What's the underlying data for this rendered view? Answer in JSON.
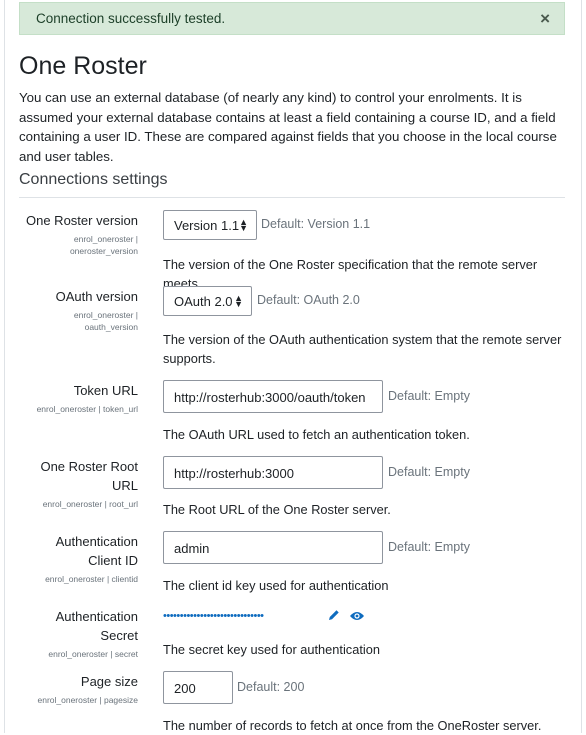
{
  "alert": {
    "message": "Connection successfully tested.",
    "close": "×"
  },
  "page": {
    "title": "One Roster",
    "intro": "You can use an external database (of nearly any kind) to control your enrolments. It is assumed your external database contains at least a field containing a course ID, and a field containing a user ID. These are compared against fields that you choose in the local course and user tables."
  },
  "section": {
    "title": "Connections settings"
  },
  "settings": {
    "version": {
      "label": "One Roster version",
      "sub1": "enrol_oneroster |",
      "sub2": "oneroster_version",
      "value": "Version 1.1",
      "default": "Default: Version 1.1",
      "desc": "The version of the One Roster specification that the remote server meets."
    },
    "oauth": {
      "label": "OAuth version",
      "sub1": "enrol_oneroster |",
      "sub2": "oauth_version",
      "value": "OAuth 2.0",
      "default": "Default: OAuth 2.0",
      "desc": "The version of the OAuth authentication system that the remote server supports."
    },
    "token": {
      "label": "Token URL",
      "sub1": "enrol_oneroster | token_url",
      "value": "http://rosterhub:3000/oauth/token",
      "default": "Default: Empty",
      "desc": "The OAuth URL used to fetch an authentication token."
    },
    "root": {
      "label": "One Roster Root URL",
      "sub1": "enrol_oneroster | root_url",
      "value": "http://rosterhub:3000",
      "default": "Default: Empty",
      "desc": "The Root URL of the One Roster server."
    },
    "client": {
      "label": "Authentication Client ID",
      "sub1": "enrol_oneroster | clientid",
      "value": "admin",
      "default": "Default: Empty",
      "desc": "The client id key used for authentication"
    },
    "secret": {
      "label": "Authentication Secret",
      "sub1": "enrol_oneroster | secret",
      "masked": "••••••••••••••••••••••••••••••",
      "desc": "The secret key used for authentication"
    },
    "pagesize": {
      "label": "Page size",
      "sub1": "enrol_oneroster | pagesize",
      "value": "200",
      "default": "Default: 200",
      "desc": "The number of records to fetch at once from the OneRoster server."
    }
  },
  "icons": {
    "edit": "pencil-icon",
    "show": "eye-icon",
    "caret": "sort-caret-icon"
  },
  "colors": {
    "link": "#0f6cbf",
    "success_bg": "#d7e9d9",
    "success_text": "#1c3f28"
  }
}
